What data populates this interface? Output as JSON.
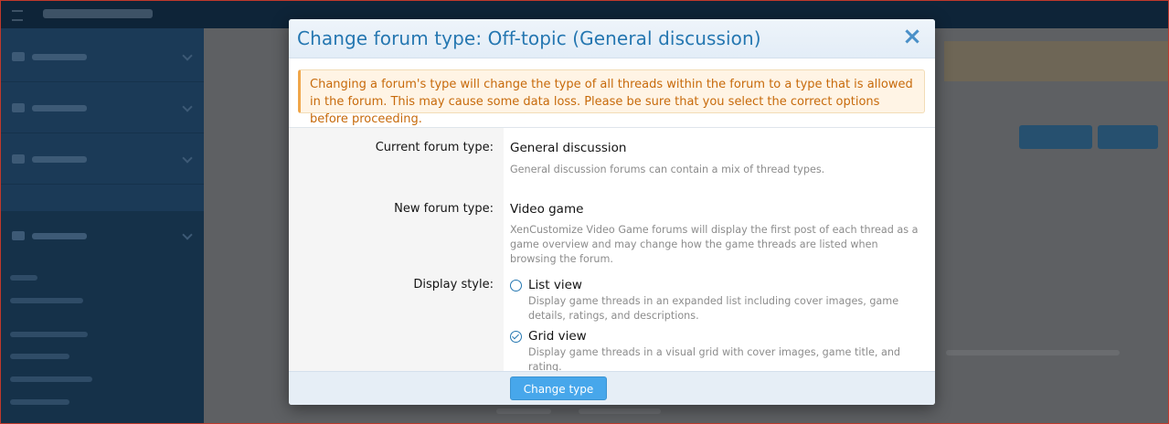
{
  "modal": {
    "title": "Change forum type: Off-topic (General discussion)",
    "notice": "Changing a forum's type will change the type of all threads within the forum to a type that is allowed in the forum. This may cause some data loss. Please be sure that you select the correct options before proceeding.",
    "current_type": {
      "label": "Current forum type:",
      "value": "General discussion",
      "hint": "General discussion forums can contain a mix of thread types."
    },
    "new_type": {
      "label": "New forum type:",
      "value": "Video game",
      "hint": "XenCustomize Video Game forums will display the first post of each thread as a game overview and may change how the game threads are listed when browsing the forum."
    },
    "display_style": {
      "label": "Display style:",
      "options": [
        {
          "label": "List view",
          "hint": "Display game threads in an expanded list including cover images, game details, ratings, and descriptions.",
          "checked": false
        },
        {
          "label": "Grid view",
          "hint": "Display game threads in a visual grid with cover images, game title, and rating.",
          "checked": true
        }
      ]
    },
    "submit_label": "Change type",
    "close_icon": "close-icon"
  },
  "colors": {
    "accent": "#2577b1",
    "button": "#47a7eb",
    "notice_text": "#c76a0b",
    "notice_bg": "#fff4e5"
  }
}
